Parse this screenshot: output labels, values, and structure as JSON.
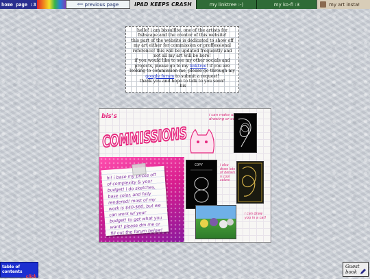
{
  "nav": {
    "home": "home page :3",
    "previous": "previous page",
    "ipad": "IPAD KEEPS CRASH",
    "linktree": "my linktree :-)",
    "kofi": "my ko-fi :3",
    "insta": "my art insta!"
  },
  "intro": {
    "line1": "hello! i am bissulfite, one of the artists for fishscape and the creator of this website!",
    "line2": "this part of the website is dedicated to show off my art either for commission or proffessional reference! this will be updated frequently and not all my art will be here!",
    "line3_pre": "if you would like to see my other socials and projects, please go to my ",
    "line3_link": "linktree",
    "line3_post": "! if you are looking to commission me, please go through my ",
    "line3_link2": "google forum",
    "line3_end": " to submit a request!",
    "line4": "thank you and hope to talk to you soon!",
    "line5": "-bis"
  },
  "board": {
    "small_title": "bis's",
    "title": "COMMISSIONS",
    "paper_text": "hi! i base my prices off of complexity & your budget! i do sketches, base color, and fully rendered! most of my work is $40-$60, but we can work w/ your budget! to get what you want! please dm me or fill out the forum below!",
    "doodle_cats": "i can make ur drawing or oc!",
    "doodle_draw": "i also draw lots of details n cool colors",
    "doodle_more": "i can draw you in a cat!",
    "copy_label": "COPY"
  },
  "toc": {
    "label": "table of contents",
    "sub": "click"
  },
  "guest": {
    "label": "Guest book"
  },
  "colors": {
    "accent_pink": "#d8287a",
    "link_blue": "#1b33d1",
    "toc_blue": "#1c2fd0"
  }
}
